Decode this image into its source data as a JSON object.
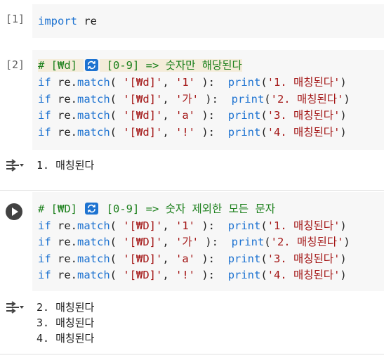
{
  "cells": [
    {
      "exec_count": "[1]",
      "code_lines": [
        [
          [
            "kw",
            "import"
          ],
          [
            "pn",
            " re"
          ]
        ]
      ]
    },
    {
      "exec_count": "[2]",
      "code_lines": [
        [
          [
            "cm hl",
            "# [₩d] "
          ],
          [
            "emoji",
            ""
          ],
          [
            "cm hl",
            " [0-9] => 숫자만 해당된다"
          ]
        ],
        [
          [
            "kw",
            "if"
          ],
          [
            "pn",
            " re."
          ],
          [
            "kw",
            "match"
          ],
          [
            "pn",
            "( "
          ],
          [
            "str",
            "'[₩d]'"
          ],
          [
            "pn",
            ", "
          ],
          [
            "str",
            "'1'"
          ],
          [
            "pn",
            " ):  "
          ],
          [
            "kw",
            "print"
          ],
          [
            "pn",
            "("
          ],
          [
            "str",
            "'1. 매칭된다'"
          ],
          [
            "pn",
            ")"
          ]
        ],
        [
          [
            "kw",
            "if"
          ],
          [
            "pn",
            " re."
          ],
          [
            "kw",
            "match"
          ],
          [
            "pn",
            "( "
          ],
          [
            "str",
            "'[₩d]'"
          ],
          [
            "pn",
            ", "
          ],
          [
            "str",
            "'가'"
          ],
          [
            "pn",
            " ):  "
          ],
          [
            "kw",
            "print"
          ],
          [
            "pn",
            "("
          ],
          [
            "str",
            "'2. 매칭된다'"
          ],
          [
            "pn",
            ")"
          ]
        ],
        [
          [
            "kw",
            "if"
          ],
          [
            "pn",
            " re."
          ],
          [
            "kw",
            "match"
          ],
          [
            "pn",
            "( "
          ],
          [
            "str",
            "'[₩d]'"
          ],
          [
            "pn",
            ", "
          ],
          [
            "str",
            "'a'"
          ],
          [
            "pn",
            " ):  "
          ],
          [
            "kw",
            "print"
          ],
          [
            "pn",
            "("
          ],
          [
            "str",
            "'3. 매칭된다'"
          ],
          [
            "pn",
            ")"
          ]
        ],
        [
          [
            "kw",
            "if"
          ],
          [
            "pn",
            " re."
          ],
          [
            "kw",
            "match"
          ],
          [
            "pn",
            "( "
          ],
          [
            "str",
            "'[₩d]'"
          ],
          [
            "pn",
            ", "
          ],
          [
            "str",
            "'!'"
          ],
          [
            "pn",
            " ):  "
          ],
          [
            "kw",
            "print"
          ],
          [
            "pn",
            "("
          ],
          [
            "str",
            "'4. 매칭된다'"
          ],
          [
            "pn",
            ")"
          ]
        ]
      ],
      "output": [
        "1. 매칭된다"
      ]
    },
    {
      "exec_count": "",
      "code_lines": [
        [
          [
            "cm",
            "# [₩D] "
          ],
          [
            "emoji",
            ""
          ],
          [
            "cm",
            " [0-9] => 숫자 제외한 모든 문자"
          ]
        ],
        [
          [
            "kw",
            "if"
          ],
          [
            "pn",
            " re."
          ],
          [
            "kw",
            "match"
          ],
          [
            "pn",
            "( "
          ],
          [
            "str",
            "'[₩D]'"
          ],
          [
            "pn",
            ", "
          ],
          [
            "str",
            "'1'"
          ],
          [
            "pn",
            " ):  "
          ],
          [
            "kw",
            "print"
          ],
          [
            "pn",
            "("
          ],
          [
            "str",
            "'1. 매칭된다'"
          ],
          [
            "pn",
            ")"
          ]
        ],
        [
          [
            "kw",
            "if"
          ],
          [
            "pn",
            " re."
          ],
          [
            "kw",
            "match"
          ],
          [
            "pn",
            "( "
          ],
          [
            "str",
            "'[₩D]'"
          ],
          [
            "pn",
            ", "
          ],
          [
            "str",
            "'가'"
          ],
          [
            "pn",
            " ):  "
          ],
          [
            "kw",
            "print"
          ],
          [
            "pn",
            "("
          ],
          [
            "str",
            "'2. 매칭된다'"
          ],
          [
            "pn",
            ")"
          ]
        ],
        [
          [
            "kw",
            "if"
          ],
          [
            "pn",
            " re."
          ],
          [
            "kw",
            "match"
          ],
          [
            "pn",
            "( "
          ],
          [
            "str",
            "'[₩D]'"
          ],
          [
            "pn",
            ", "
          ],
          [
            "str",
            "'a'"
          ],
          [
            "pn",
            " ):  "
          ],
          [
            "kw",
            "print"
          ],
          [
            "pn",
            "("
          ],
          [
            "str",
            "'3. 매칭된다'"
          ],
          [
            "pn",
            ")"
          ]
        ],
        [
          [
            "kw",
            "if"
          ],
          [
            "pn",
            " re."
          ],
          [
            "kw",
            "match"
          ],
          [
            "pn",
            "( "
          ],
          [
            "str",
            "'[₩D]'"
          ],
          [
            "pn",
            ", "
          ],
          [
            "str",
            "'!'"
          ],
          [
            "pn",
            " ):  "
          ],
          [
            "kw",
            "print"
          ],
          [
            "pn",
            "("
          ],
          [
            "str",
            "'4. 매칭된다'"
          ],
          [
            "pn",
            ")"
          ]
        ]
      ],
      "output": [
        "2. 매칭된다",
        "3. 매칭된다",
        "4. 매칭된다"
      ]
    }
  ],
  "icons": {
    "run": "play-icon",
    "output_toggle": "output-toggle-icon",
    "emoji": "repeat-emoji-icon"
  },
  "colors": {
    "keyword": "#1e73d1",
    "string": "#a31515",
    "comment": "#1a7f1a",
    "cell_bg": "#f7f7f7"
  }
}
